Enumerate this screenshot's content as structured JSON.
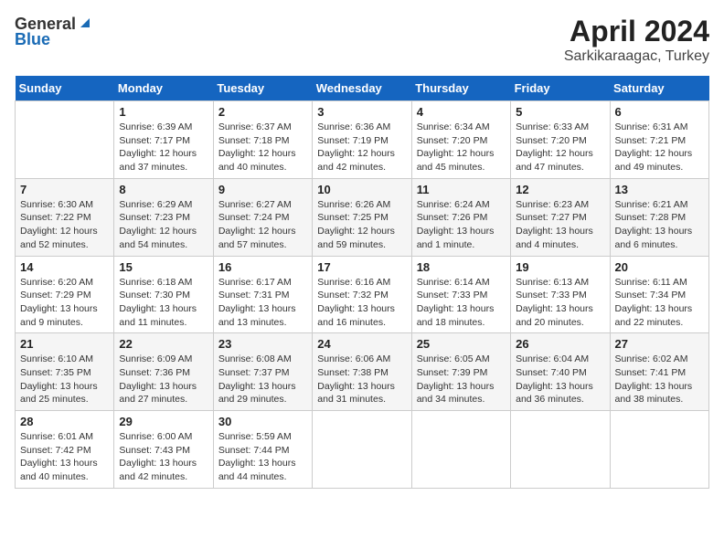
{
  "logo": {
    "general": "General",
    "blue": "Blue"
  },
  "header": {
    "month": "April 2024",
    "location": "Sarkikaraagac, Turkey"
  },
  "weekdays": [
    "Sunday",
    "Monday",
    "Tuesday",
    "Wednesday",
    "Thursday",
    "Friday",
    "Saturday"
  ],
  "weeks": [
    [
      {
        "day": "",
        "info": ""
      },
      {
        "day": "1",
        "info": "Sunrise: 6:39 AM\nSunset: 7:17 PM\nDaylight: 12 hours\nand 37 minutes."
      },
      {
        "day": "2",
        "info": "Sunrise: 6:37 AM\nSunset: 7:18 PM\nDaylight: 12 hours\nand 40 minutes."
      },
      {
        "day": "3",
        "info": "Sunrise: 6:36 AM\nSunset: 7:19 PM\nDaylight: 12 hours\nand 42 minutes."
      },
      {
        "day": "4",
        "info": "Sunrise: 6:34 AM\nSunset: 7:20 PM\nDaylight: 12 hours\nand 45 minutes."
      },
      {
        "day": "5",
        "info": "Sunrise: 6:33 AM\nSunset: 7:20 PM\nDaylight: 12 hours\nand 47 minutes."
      },
      {
        "day": "6",
        "info": "Sunrise: 6:31 AM\nSunset: 7:21 PM\nDaylight: 12 hours\nand 49 minutes."
      }
    ],
    [
      {
        "day": "7",
        "info": "Sunrise: 6:30 AM\nSunset: 7:22 PM\nDaylight: 12 hours\nand 52 minutes."
      },
      {
        "day": "8",
        "info": "Sunrise: 6:29 AM\nSunset: 7:23 PM\nDaylight: 12 hours\nand 54 minutes."
      },
      {
        "day": "9",
        "info": "Sunrise: 6:27 AM\nSunset: 7:24 PM\nDaylight: 12 hours\nand 57 minutes."
      },
      {
        "day": "10",
        "info": "Sunrise: 6:26 AM\nSunset: 7:25 PM\nDaylight: 12 hours\nand 59 minutes."
      },
      {
        "day": "11",
        "info": "Sunrise: 6:24 AM\nSunset: 7:26 PM\nDaylight: 13 hours\nand 1 minute."
      },
      {
        "day": "12",
        "info": "Sunrise: 6:23 AM\nSunset: 7:27 PM\nDaylight: 13 hours\nand 4 minutes."
      },
      {
        "day": "13",
        "info": "Sunrise: 6:21 AM\nSunset: 7:28 PM\nDaylight: 13 hours\nand 6 minutes."
      }
    ],
    [
      {
        "day": "14",
        "info": "Sunrise: 6:20 AM\nSunset: 7:29 PM\nDaylight: 13 hours\nand 9 minutes."
      },
      {
        "day": "15",
        "info": "Sunrise: 6:18 AM\nSunset: 7:30 PM\nDaylight: 13 hours\nand 11 minutes."
      },
      {
        "day": "16",
        "info": "Sunrise: 6:17 AM\nSunset: 7:31 PM\nDaylight: 13 hours\nand 13 minutes."
      },
      {
        "day": "17",
        "info": "Sunrise: 6:16 AM\nSunset: 7:32 PM\nDaylight: 13 hours\nand 16 minutes."
      },
      {
        "day": "18",
        "info": "Sunrise: 6:14 AM\nSunset: 7:33 PM\nDaylight: 13 hours\nand 18 minutes."
      },
      {
        "day": "19",
        "info": "Sunrise: 6:13 AM\nSunset: 7:33 PM\nDaylight: 13 hours\nand 20 minutes."
      },
      {
        "day": "20",
        "info": "Sunrise: 6:11 AM\nSunset: 7:34 PM\nDaylight: 13 hours\nand 22 minutes."
      }
    ],
    [
      {
        "day": "21",
        "info": "Sunrise: 6:10 AM\nSunset: 7:35 PM\nDaylight: 13 hours\nand 25 minutes."
      },
      {
        "day": "22",
        "info": "Sunrise: 6:09 AM\nSunset: 7:36 PM\nDaylight: 13 hours\nand 27 minutes."
      },
      {
        "day": "23",
        "info": "Sunrise: 6:08 AM\nSunset: 7:37 PM\nDaylight: 13 hours\nand 29 minutes."
      },
      {
        "day": "24",
        "info": "Sunrise: 6:06 AM\nSunset: 7:38 PM\nDaylight: 13 hours\nand 31 minutes."
      },
      {
        "day": "25",
        "info": "Sunrise: 6:05 AM\nSunset: 7:39 PM\nDaylight: 13 hours\nand 34 minutes."
      },
      {
        "day": "26",
        "info": "Sunrise: 6:04 AM\nSunset: 7:40 PM\nDaylight: 13 hours\nand 36 minutes."
      },
      {
        "day": "27",
        "info": "Sunrise: 6:02 AM\nSunset: 7:41 PM\nDaylight: 13 hours\nand 38 minutes."
      }
    ],
    [
      {
        "day": "28",
        "info": "Sunrise: 6:01 AM\nSunset: 7:42 PM\nDaylight: 13 hours\nand 40 minutes."
      },
      {
        "day": "29",
        "info": "Sunrise: 6:00 AM\nSunset: 7:43 PM\nDaylight: 13 hours\nand 42 minutes."
      },
      {
        "day": "30",
        "info": "Sunrise: 5:59 AM\nSunset: 7:44 PM\nDaylight: 13 hours\nand 44 minutes."
      },
      {
        "day": "",
        "info": ""
      },
      {
        "day": "",
        "info": ""
      },
      {
        "day": "",
        "info": ""
      },
      {
        "day": "",
        "info": ""
      }
    ]
  ]
}
